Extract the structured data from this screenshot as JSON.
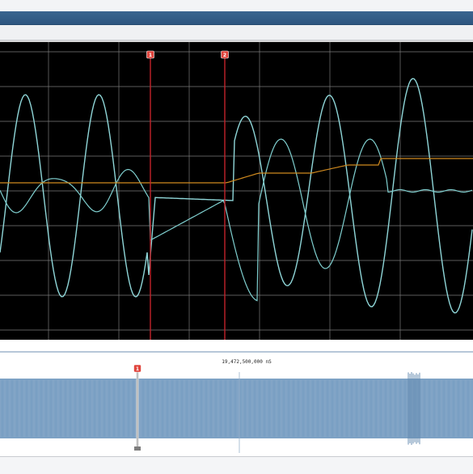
{
  "colors": {
    "window_titlebar": "#2e5680",
    "scope_background": "#000000",
    "grid": "#7f7f7f",
    "waveform_cyan": "#8fd6d8",
    "waveform_amber": "#d08a1f",
    "cursor_red": "#d0282f",
    "overview_fill": "#7ea2c5"
  },
  "scope": {
    "cursors": [
      {
        "label": "1"
      },
      {
        "label": "2"
      }
    ]
  },
  "overview": {
    "timestamp": "19,472,500,000 nS",
    "marker_label": "1"
  }
}
